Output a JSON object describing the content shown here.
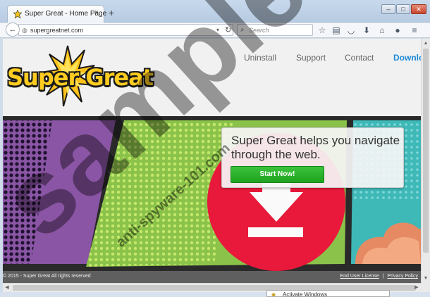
{
  "browser": {
    "tab_title": "Super Great - Home Page",
    "tab_close": "×",
    "new_tab": "+",
    "url": "supergreatnet.com",
    "search_placeholder": "Search",
    "window_buttons": {
      "minimize": "–",
      "maximize": "□",
      "close": "✕"
    }
  },
  "site": {
    "logo_text": "Super Great",
    "nav": {
      "uninstall": "Uninstall",
      "support": "Support",
      "contact": "Contact",
      "download": "Download"
    },
    "promo_text": "Super Great helps you navigate through the web.",
    "start_button": "Start Now!",
    "footer_copy": "© 2015 - Super Great All rights reserved",
    "footer_links": {
      "eula": "End User License",
      "separator": "|",
      "privacy": "Privacy Policy"
    }
  },
  "popup": {
    "text": "Activate Windows"
  },
  "watermark": {
    "main": "sample",
    "sub": "anti-spyware-101.com"
  },
  "colors": {
    "brand_yellow": "#ffcc1f",
    "download_blue": "#1d8ad8",
    "start_green": "#2cb32c",
    "panel_purple": "#8a55a4",
    "panel_green": "#8bc34a",
    "panel_teal": "#3fb8b8",
    "circle_red": "#e8193b"
  }
}
